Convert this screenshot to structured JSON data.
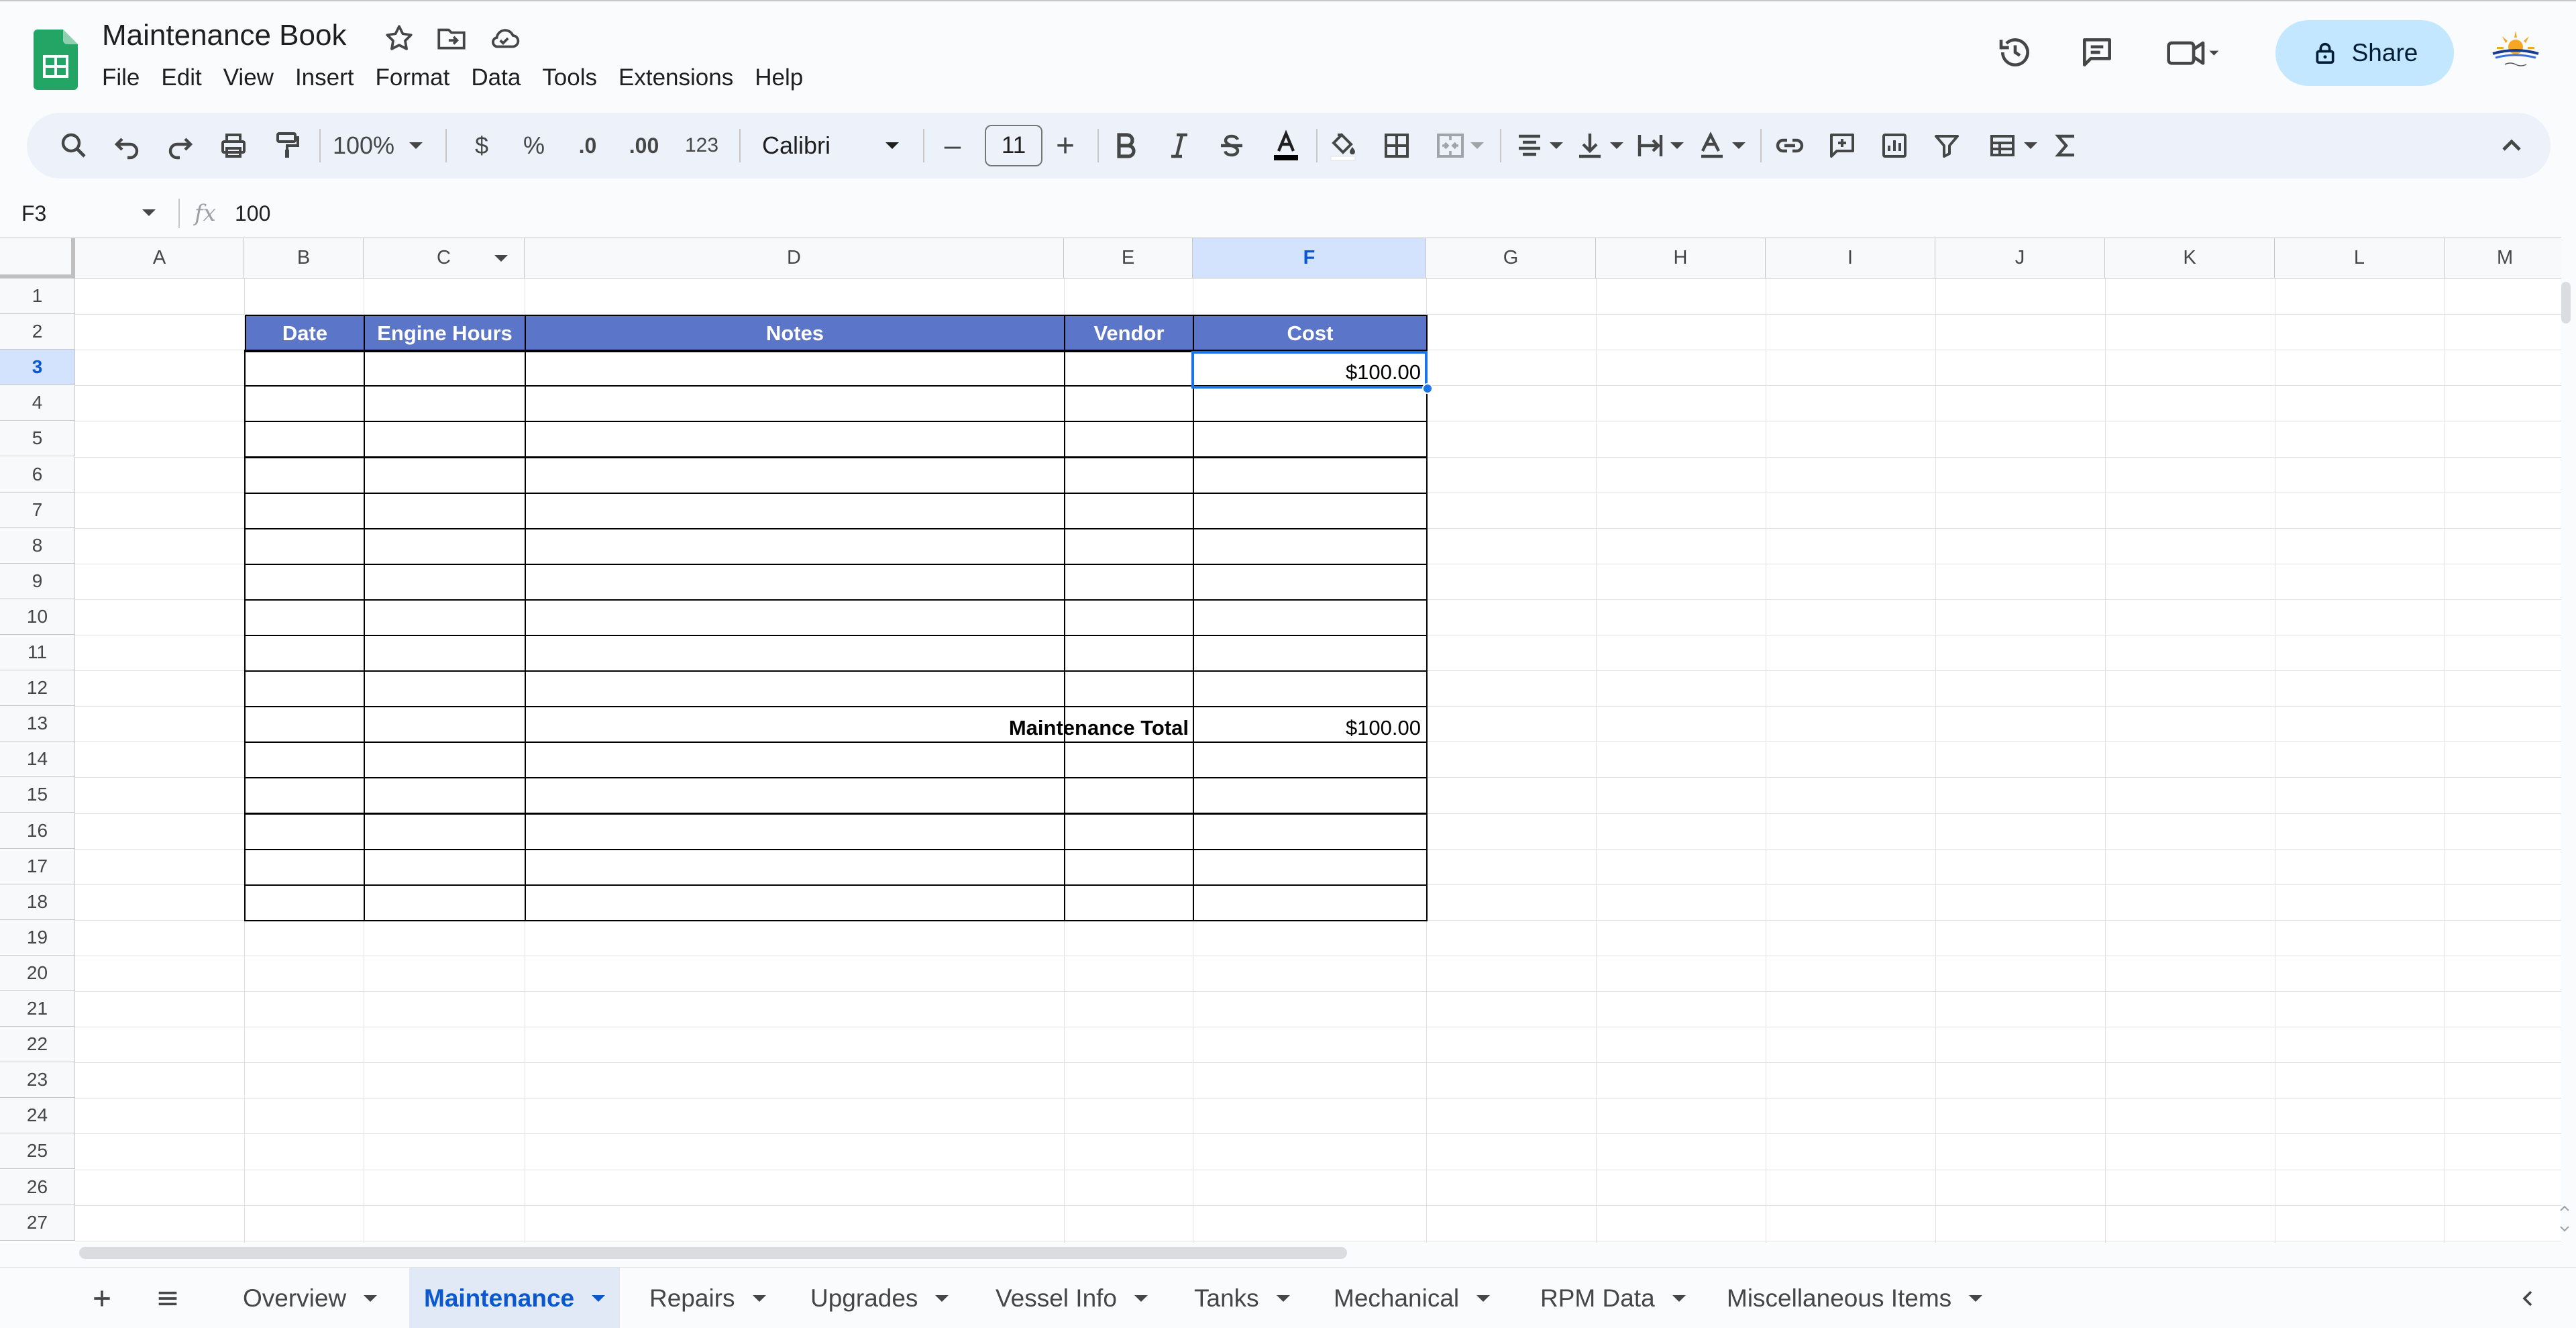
{
  "document": {
    "title": "Maintenance Book",
    "menu": [
      "File",
      "Edit",
      "View",
      "Insert",
      "Format",
      "Data",
      "Tools",
      "Extensions",
      "Help"
    ],
    "share_label": "Share"
  },
  "toolbar": {
    "zoom": "100%",
    "currency_symbol": "$",
    "percent_symbol": "%",
    "decrease_decimal_label": ".0",
    "increase_decimal_label": ".00",
    "number_format_label": "123",
    "font_family": "Calibri",
    "font_size": "11",
    "minus_symbol": "–",
    "plus_symbol": "+"
  },
  "formula_bar": {
    "cell_ref": "F3",
    "fx": "fx",
    "value": "100"
  },
  "grid": {
    "columns": [
      "A",
      "B",
      "C",
      "D",
      "E",
      "F",
      "G",
      "H",
      "I",
      "J",
      "K",
      "L",
      "M"
    ],
    "rows": [
      "1",
      "2",
      "3",
      "4",
      "5",
      "6",
      "7",
      "8",
      "9",
      "10",
      "11",
      "12",
      "13",
      "14",
      "15",
      "16",
      "17",
      "18",
      "19",
      "20",
      "21",
      "22",
      "23",
      "24",
      "25",
      "26",
      "27"
    ],
    "selected_column": "F",
    "selected_row": "3",
    "table_headers": [
      "Date",
      "Engine Hours",
      "Notes",
      "Vendor",
      "Cost"
    ],
    "f3_value": "$100.00",
    "total_label": "Maintenance Total",
    "total_value": "$100.00"
  },
  "sheets": {
    "tabs": [
      "Overview",
      "Maintenance",
      "Repairs",
      "Upgrades",
      "Vessel Info",
      "Tanks",
      "Mechanical",
      "RPM Data",
      "Miscellaneous Items"
    ],
    "active": "Maintenance"
  },
  "colors": {
    "header_fill": "#5b76c9",
    "accent": "#0b57d0",
    "share_bg": "#c2e7ff",
    "selection": "#1a73e8"
  }
}
